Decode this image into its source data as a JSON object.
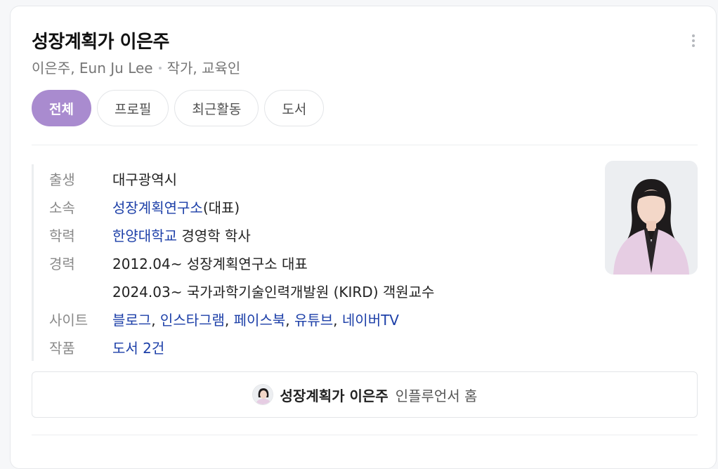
{
  "header": {
    "title": "성장계획가 이은주",
    "subtitle_names": "이은주, Eun Ju Lee",
    "subtitle_roles": "작가, 교육인"
  },
  "tabs": [
    {
      "label": "전체",
      "active": true
    },
    {
      "label": "프로필",
      "active": false
    },
    {
      "label": "최근활동",
      "active": false
    },
    {
      "label": "도서",
      "active": false
    }
  ],
  "profile": {
    "birth": {
      "label": "출생",
      "value": "대구광역시"
    },
    "affiliation": {
      "label": "소속",
      "link": "성장계획연구소",
      "suffix": "(대표)"
    },
    "education": {
      "label": "학력",
      "link": "한양대학교",
      "suffix": " 경영학 학사"
    },
    "career": {
      "label": "경력",
      "items": [
        "2012.04~ 성장계획연구소 대표",
        "2024.03~ 국가과학기술인력개발원 (KIRD) 객원교수"
      ]
    },
    "sites": {
      "label": "사이트",
      "links": [
        "블로그",
        "인스타그램",
        "페이스북",
        "유튜브",
        "네이버TV"
      ],
      "separator": ","
    },
    "works": {
      "label": "작품",
      "link": "도서 2건"
    }
  },
  "footer": {
    "name": "성장계획가 이은주",
    "suffix": "인플루언서 홈"
  },
  "colors": {
    "accent": "#a98bcf",
    "link": "#1c3fa8"
  },
  "icons": {
    "more": "more-vertical-icon"
  }
}
